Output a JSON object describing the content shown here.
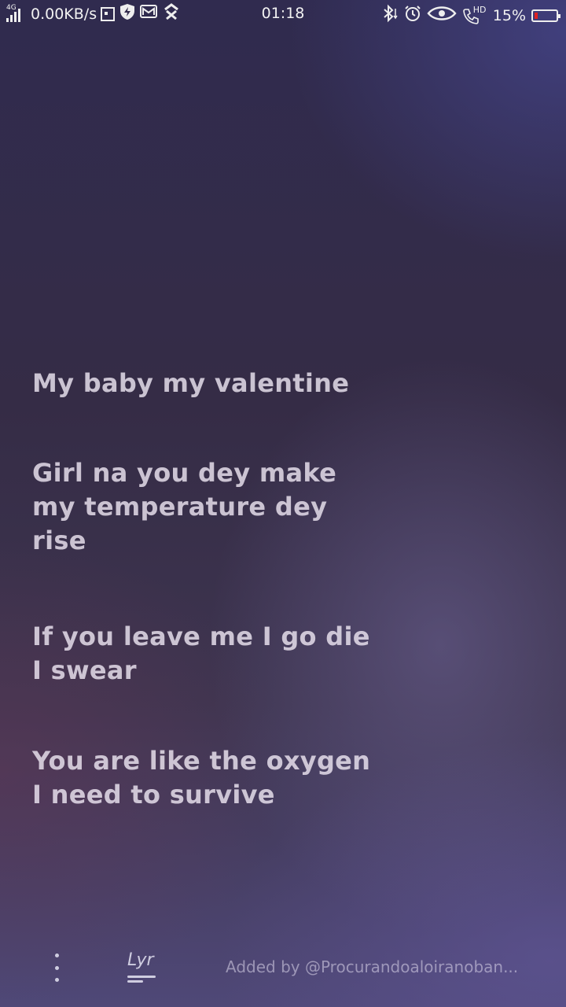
{
  "status_bar": {
    "network_tag": "4G",
    "speed": "0.00KB/s",
    "time": "01:18",
    "hd_tag": "HD",
    "battery_percent": "15%",
    "battery_level": 0.15,
    "battery_color": "#e02020"
  },
  "lyrics": {
    "verse1": [
      "My baby my valentine"
    ],
    "verse2": [
      "Girl na you dey make",
      "my temperature dey",
      "rise"
    ],
    "verse3": [
      "If you leave me I go die",
      "I swear"
    ],
    "verse4": [
      "You are like the oxygen",
      "I need to survive"
    ]
  },
  "bottom": {
    "logo_text": "Lyr",
    "added_by": "Added by @Procurandoaloiranoban..."
  }
}
